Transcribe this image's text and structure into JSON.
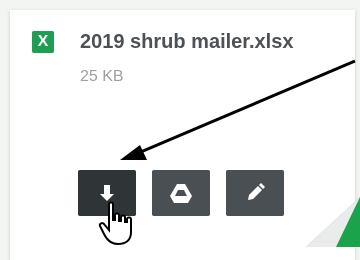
{
  "file": {
    "type_icon": "excel-icon",
    "type_letter": "X",
    "name": "2019 shrub mailer.xlsx",
    "size": "25 KB"
  },
  "actions": [
    {
      "name": "download",
      "icon": "download-icon"
    },
    {
      "name": "google-drive",
      "icon": "google-drive-icon"
    },
    {
      "name": "edit",
      "icon": "pencil-icon"
    }
  ],
  "colors": {
    "excel_green": "#1f9d55",
    "button_dark": "#4a4f53",
    "corner_green": "#1aa34a"
  }
}
